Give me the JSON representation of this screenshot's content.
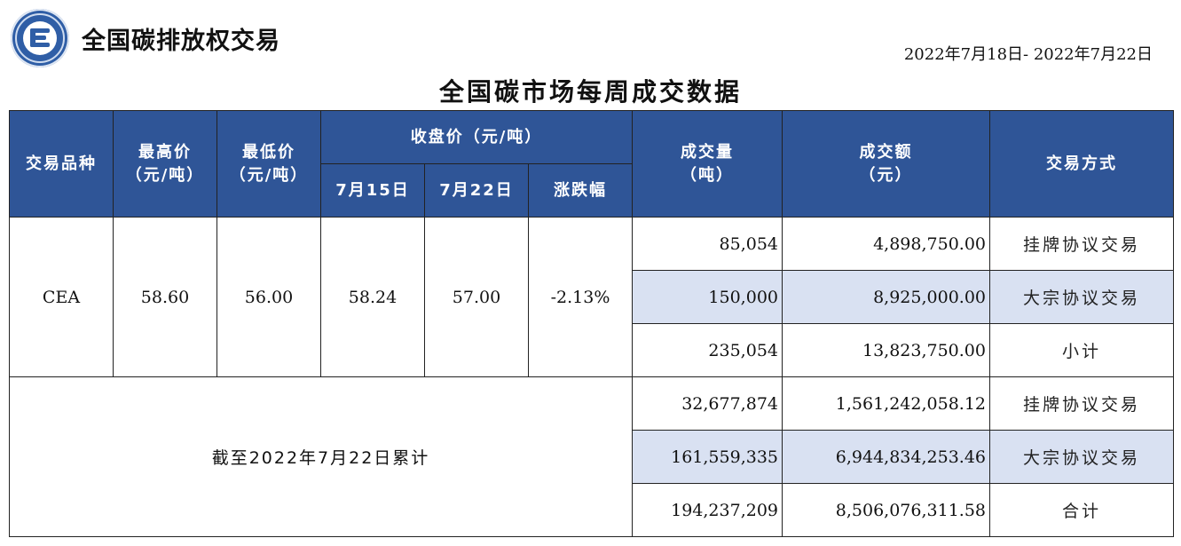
{
  "header": {
    "brand": "全国碳排放权交易",
    "date_range": "2022年7月18日- 2022年7月22日",
    "title": "全国碳市场每周成交数据"
  },
  "columns": {
    "product": "交易品种",
    "high": "最高价\n（元/吨）",
    "low": "最低价\n（元/吨）",
    "close_group": "收盘价（元/吨）",
    "close_prev": "7月15日",
    "close_curr": "7月22日",
    "change": "涨跌幅",
    "volume": "成交量\n（吨）",
    "amount": "成交额\n（元）",
    "method": "交易方式"
  },
  "weekly": {
    "product": "CEA",
    "high": "58.60",
    "low": "56.00",
    "close_prev": "58.24",
    "close_curr": "57.00",
    "change": "-2.13%",
    "rows": [
      {
        "volume": "85,054",
        "amount": "4,898,750.00",
        "method": "挂牌协议交易"
      },
      {
        "volume": "150,000",
        "amount": "8,925,000.00",
        "method": "大宗协议交易"
      },
      {
        "volume": "235,054",
        "amount": "13,823,750.00",
        "method": "小计"
      }
    ]
  },
  "cumulative": {
    "label": "截至2022年7月22日累计",
    "rows": [
      {
        "volume": "32,677,874",
        "amount": "1,561,242,058.12",
        "method": "挂牌协议交易"
      },
      {
        "volume": "161,559,335",
        "amount": "6,944,834,253.46",
        "method": "大宗协议交易"
      },
      {
        "volume": "194,237,209",
        "amount": "8,506,076,311.58",
        "method": "合计"
      }
    ]
  },
  "colors": {
    "header_bg": "#2f5597",
    "shade": "#d9e1f2",
    "logo": "#2f5ea6"
  }
}
